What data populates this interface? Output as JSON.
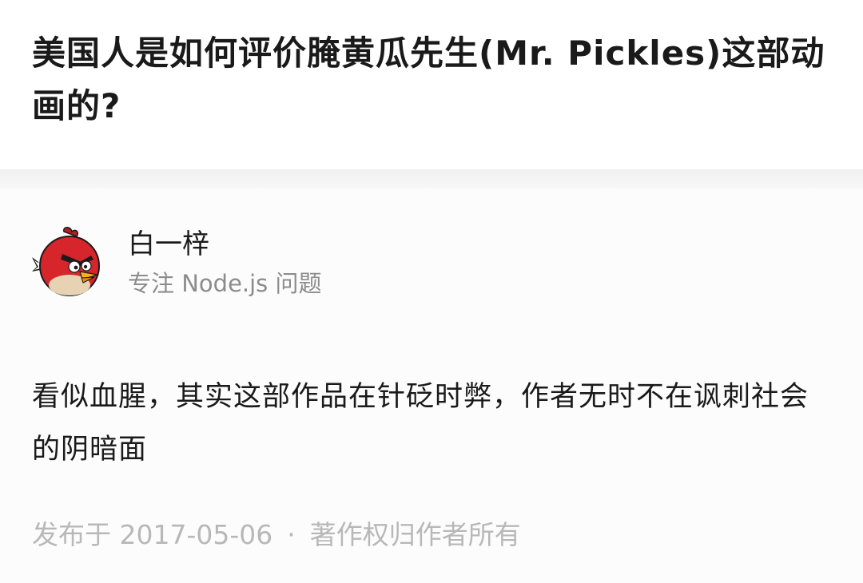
{
  "question": {
    "title": "美国人是如何评价腌黄瓜先生(Mr. Pickles)这部动画的?"
  },
  "answer": {
    "author": {
      "name": "白一梓",
      "bio": "专注 Node.js 问题",
      "avatar_icon": "angry-bird-red-avatar"
    },
    "content": "看似血腥，其实这部作品在针砭时弊，作者无时不在讽刺社会的阴暗面",
    "meta": {
      "published": "发布于 2017-05-06",
      "separator": "·",
      "copyright": "著作权归作者所有"
    }
  },
  "colors": {
    "page_background": "#f6f6f6",
    "card_background": "#fcfcfc",
    "header_background": "#ffffff",
    "title_text": "#1a1a1a",
    "secondary_text": "#8c8c8c",
    "meta_text": "#b8b8b8",
    "avatar_red": "#d7262b"
  }
}
